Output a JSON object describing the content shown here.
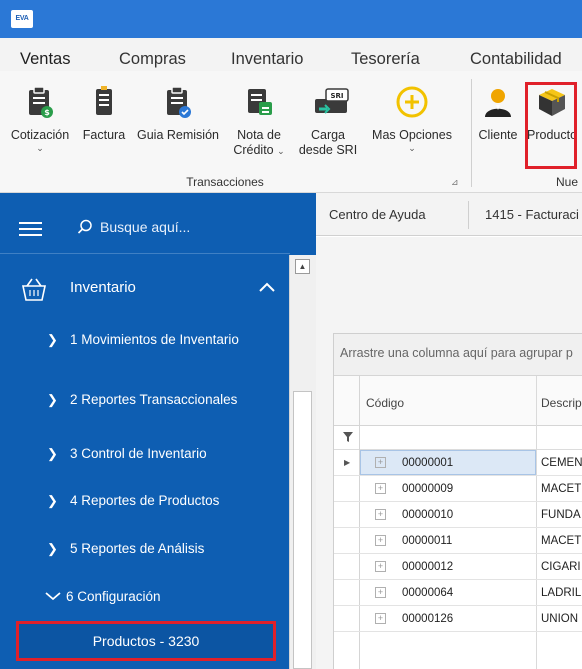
{
  "app": {
    "logo_text": "EVA"
  },
  "menu": {
    "tabs": [
      "Ventas",
      "Compras",
      "Inventario",
      "Tesorería",
      "Contabilidad"
    ],
    "active": "Ventas"
  },
  "ribbon": {
    "buttons": [
      {
        "id": "cotizacion",
        "line1": "Cotización",
        "line2": "",
        "chevron": true,
        "icon": "clipboard-dollar-icon"
      },
      {
        "id": "factura",
        "line1": "Factura",
        "line2": "",
        "chevron": false,
        "icon": "receipt-icon"
      },
      {
        "id": "guia",
        "line1": "Guia Remisión",
        "line2": "",
        "chevron": false,
        "icon": "clipboard-check-icon"
      },
      {
        "id": "nota",
        "line1": "Nota de",
        "line2": "Crédito",
        "chevron": true,
        "icon": "credit-note-icon"
      },
      {
        "id": "carga",
        "line1": "Carga",
        "line2": "desde SRI",
        "chevron": false,
        "icon": "sri-upload-icon"
      },
      {
        "id": "mas",
        "line1": "Mas Opciones",
        "line2": "",
        "chevron": true,
        "icon": "plus-circle-icon"
      },
      {
        "id": "cliente",
        "line1": "Cliente",
        "line2": "",
        "chevron": false,
        "icon": "user-icon"
      },
      {
        "id": "producto",
        "line1": "Producto",
        "line2": "",
        "chevron": false,
        "icon": "box-icon"
      }
    ],
    "group_transacciones": "Transacciones",
    "group_nuevo": "Nue",
    "sri_badge": "SRI"
  },
  "sidebar": {
    "search_placeholder": "Busque aquí...",
    "section_label": "Inventario",
    "items": [
      {
        "label": "1 Movimientos de Inventario",
        "expanded": false
      },
      {
        "label": "2 Reportes Transaccionales",
        "expanded": false
      },
      {
        "label": "3 Control de Inventario",
        "expanded": false
      },
      {
        "label": "4 Reportes de Productos",
        "expanded": false
      },
      {
        "label": "5 Reportes de Análisis",
        "expanded": false
      },
      {
        "label": "6 Configuración",
        "expanded": true
      }
    ],
    "sub_item": "Productos - 3230"
  },
  "doc_tabs": [
    "Centro de Ayuda",
    "1415 - Facturaci"
  ],
  "grid": {
    "group_panel_text": "Arrastre una columna aquí para agrupar p",
    "columns": [
      "Código",
      "Descripc"
    ],
    "rows": [
      {
        "code": "00000001",
        "desc": "CEMEN",
        "selected": true
      },
      {
        "code": "00000009",
        "desc": "MACET",
        "selected": false
      },
      {
        "code": "00000010",
        "desc": "FUNDA",
        "selected": false
      },
      {
        "code": "00000011",
        "desc": "MACET",
        "selected": false
      },
      {
        "code": "00000012",
        "desc": "CIGARI",
        "selected": false
      },
      {
        "code": "00000064",
        "desc": "LADRIL",
        "selected": false
      },
      {
        "code": "00000126",
        "desc": "UNION",
        "selected": false
      }
    ]
  },
  "colors": {
    "titlebar": "#2b78d6",
    "sidebar": "#0e5eb2",
    "highlight": "#e0202a"
  }
}
